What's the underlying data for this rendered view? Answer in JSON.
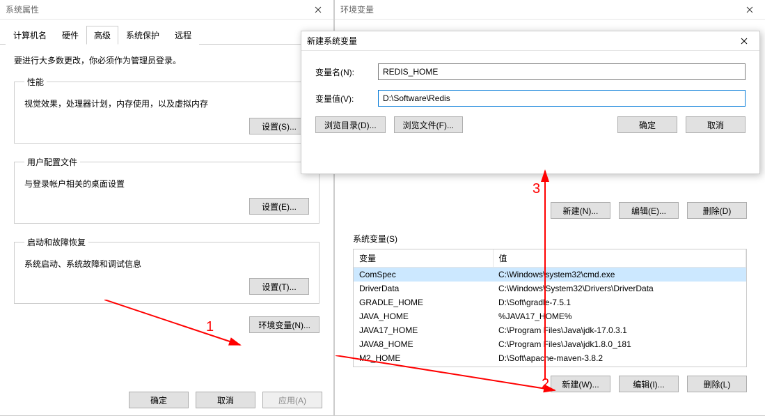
{
  "sysprops": {
    "title": "系统属性",
    "tabs": [
      "计算机名",
      "硬件",
      "高级",
      "系统保护",
      "远程"
    ],
    "note": "要进行大多数更改，你必须作为管理员登录。",
    "perf": {
      "legend": "性能",
      "desc": "视觉效果，处理器计划，内存使用，以及虚拟内存",
      "btn": "设置(S)..."
    },
    "profiles": {
      "legend": "用户配置文件",
      "desc": "与登录帐户相关的桌面设置",
      "btn": "设置(E)..."
    },
    "startup": {
      "legend": "启动和故障恢复",
      "desc": "系统启动、系统故障和调试信息",
      "btn": "设置(T)..."
    },
    "env_btn": "环境变量(N)...",
    "ok": "确定",
    "cancel": "取消",
    "apply": "应用(A)"
  },
  "envvars": {
    "title": "环境变量",
    "sys_label": "系统变量(S)",
    "col_var": "变量",
    "col_val": "值",
    "rows": [
      {
        "var": "ComSpec",
        "val": "C:\\Windows\\system32\\cmd.exe"
      },
      {
        "var": "DriverData",
        "val": "C:\\Windows\\System32\\Drivers\\DriverData"
      },
      {
        "var": "GRADLE_HOME",
        "val": "D:\\Soft\\gradle-7.5.1"
      },
      {
        "var": "JAVA_HOME",
        "val": "%JAVA17_HOME%"
      },
      {
        "var": "JAVA17_HOME",
        "val": "C:\\Program Files\\Java\\jdk-17.0.3.1"
      },
      {
        "var": "JAVA8_HOME",
        "val": "C:\\Program Files\\Java\\jdk1.8.0_181"
      },
      {
        "var": "M2_HOME",
        "val": "D:\\Soft\\apache-maven-3.8.2"
      }
    ],
    "new_u": "新建(N)...",
    "edit_u": "编辑(E)...",
    "del_u": "删除(D)",
    "new_s": "新建(W)...",
    "edit_s": "编辑(I)...",
    "del_s": "删除(L)"
  },
  "newvar": {
    "title": "新建系统变量",
    "name_label": "变量名(N):",
    "name_value": "REDIS_HOME",
    "value_label": "变量值(V):",
    "value_value": "D:\\Software\\Redis",
    "browse_dir": "浏览目录(D)...",
    "browse_file": "浏览文件(F)...",
    "ok": "确定",
    "cancel": "取消"
  },
  "anno": {
    "n1": "1",
    "n2": "2",
    "n3": "3"
  }
}
